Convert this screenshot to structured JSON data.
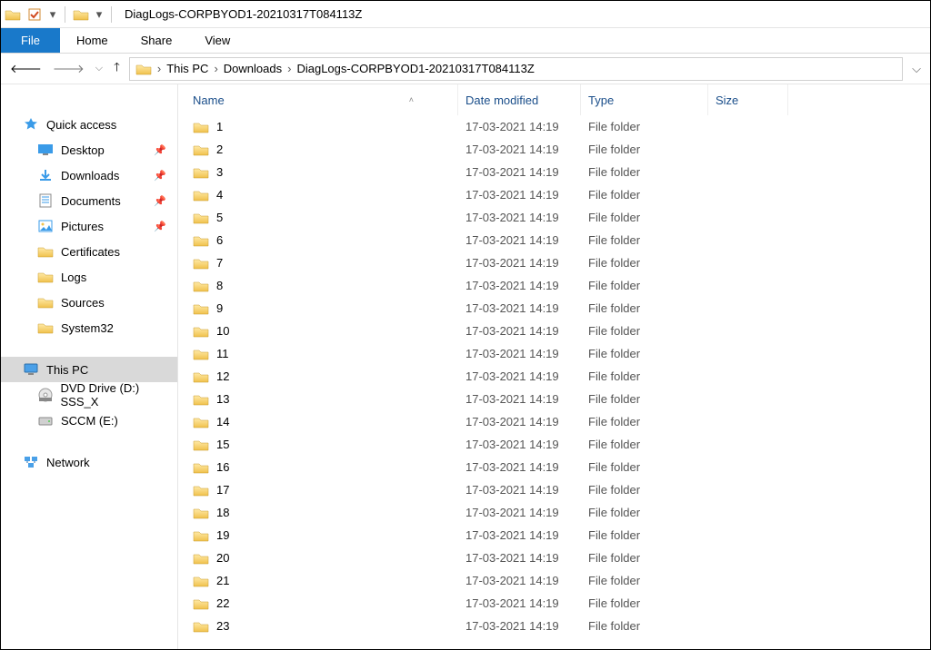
{
  "title": "DiagLogs-CORPBYOD1-20210317T084113Z",
  "ribbon": {
    "file": "File",
    "tabs": [
      "Home",
      "Share",
      "View"
    ]
  },
  "breadcrumbs": [
    "This PC",
    "Downloads",
    "DiagLogs-CORPBYOD1-20210317T084113Z"
  ],
  "columns": {
    "name": "Name",
    "date": "Date modified",
    "type": "Type",
    "size": "Size"
  },
  "nav": {
    "quick_access": "Quick access",
    "quick_items": [
      {
        "label": "Desktop",
        "icon": "desktop",
        "pinned": true
      },
      {
        "label": "Downloads",
        "icon": "down",
        "pinned": true
      },
      {
        "label": "Documents",
        "icon": "doc",
        "pinned": true
      },
      {
        "label": "Pictures",
        "icon": "pic",
        "pinned": true
      },
      {
        "label": "Certificates",
        "icon": "folder",
        "pinned": false
      },
      {
        "label": "Logs",
        "icon": "folder",
        "pinned": false
      },
      {
        "label": "Sources",
        "icon": "folder",
        "pinned": false
      },
      {
        "label": "System32",
        "icon": "folder",
        "pinned": false
      }
    ],
    "this_pc": "This PC",
    "drives": [
      {
        "label": "DVD Drive (D:) SSS_X",
        "icon": "dvd"
      },
      {
        "label": "SCCM (E:)",
        "icon": "drive"
      }
    ],
    "network": "Network"
  },
  "rows": [
    {
      "name": "1",
      "date": "17-03-2021 14:19",
      "type": "File folder"
    },
    {
      "name": "2",
      "date": "17-03-2021 14:19",
      "type": "File folder"
    },
    {
      "name": "3",
      "date": "17-03-2021 14:19",
      "type": "File folder"
    },
    {
      "name": "4",
      "date": "17-03-2021 14:19",
      "type": "File folder"
    },
    {
      "name": "5",
      "date": "17-03-2021 14:19",
      "type": "File folder"
    },
    {
      "name": "6",
      "date": "17-03-2021 14:19",
      "type": "File folder"
    },
    {
      "name": "7",
      "date": "17-03-2021 14:19",
      "type": "File folder"
    },
    {
      "name": "8",
      "date": "17-03-2021 14:19",
      "type": "File folder"
    },
    {
      "name": "9",
      "date": "17-03-2021 14:19",
      "type": "File folder"
    },
    {
      "name": "10",
      "date": "17-03-2021 14:19",
      "type": "File folder"
    },
    {
      "name": "11",
      "date": "17-03-2021 14:19",
      "type": "File folder"
    },
    {
      "name": "12",
      "date": "17-03-2021 14:19",
      "type": "File folder"
    },
    {
      "name": "13",
      "date": "17-03-2021 14:19",
      "type": "File folder"
    },
    {
      "name": "14",
      "date": "17-03-2021 14:19",
      "type": "File folder"
    },
    {
      "name": "15",
      "date": "17-03-2021 14:19",
      "type": "File folder"
    },
    {
      "name": "16",
      "date": "17-03-2021 14:19",
      "type": "File folder"
    },
    {
      "name": "17",
      "date": "17-03-2021 14:19",
      "type": "File folder"
    },
    {
      "name": "18",
      "date": "17-03-2021 14:19",
      "type": "File folder"
    },
    {
      "name": "19",
      "date": "17-03-2021 14:19",
      "type": "File folder"
    },
    {
      "name": "20",
      "date": "17-03-2021 14:19",
      "type": "File folder"
    },
    {
      "name": "21",
      "date": "17-03-2021 14:19",
      "type": "File folder"
    },
    {
      "name": "22",
      "date": "17-03-2021 14:19",
      "type": "File folder"
    },
    {
      "name": "23",
      "date": "17-03-2021 14:19",
      "type": "File folder"
    }
  ]
}
